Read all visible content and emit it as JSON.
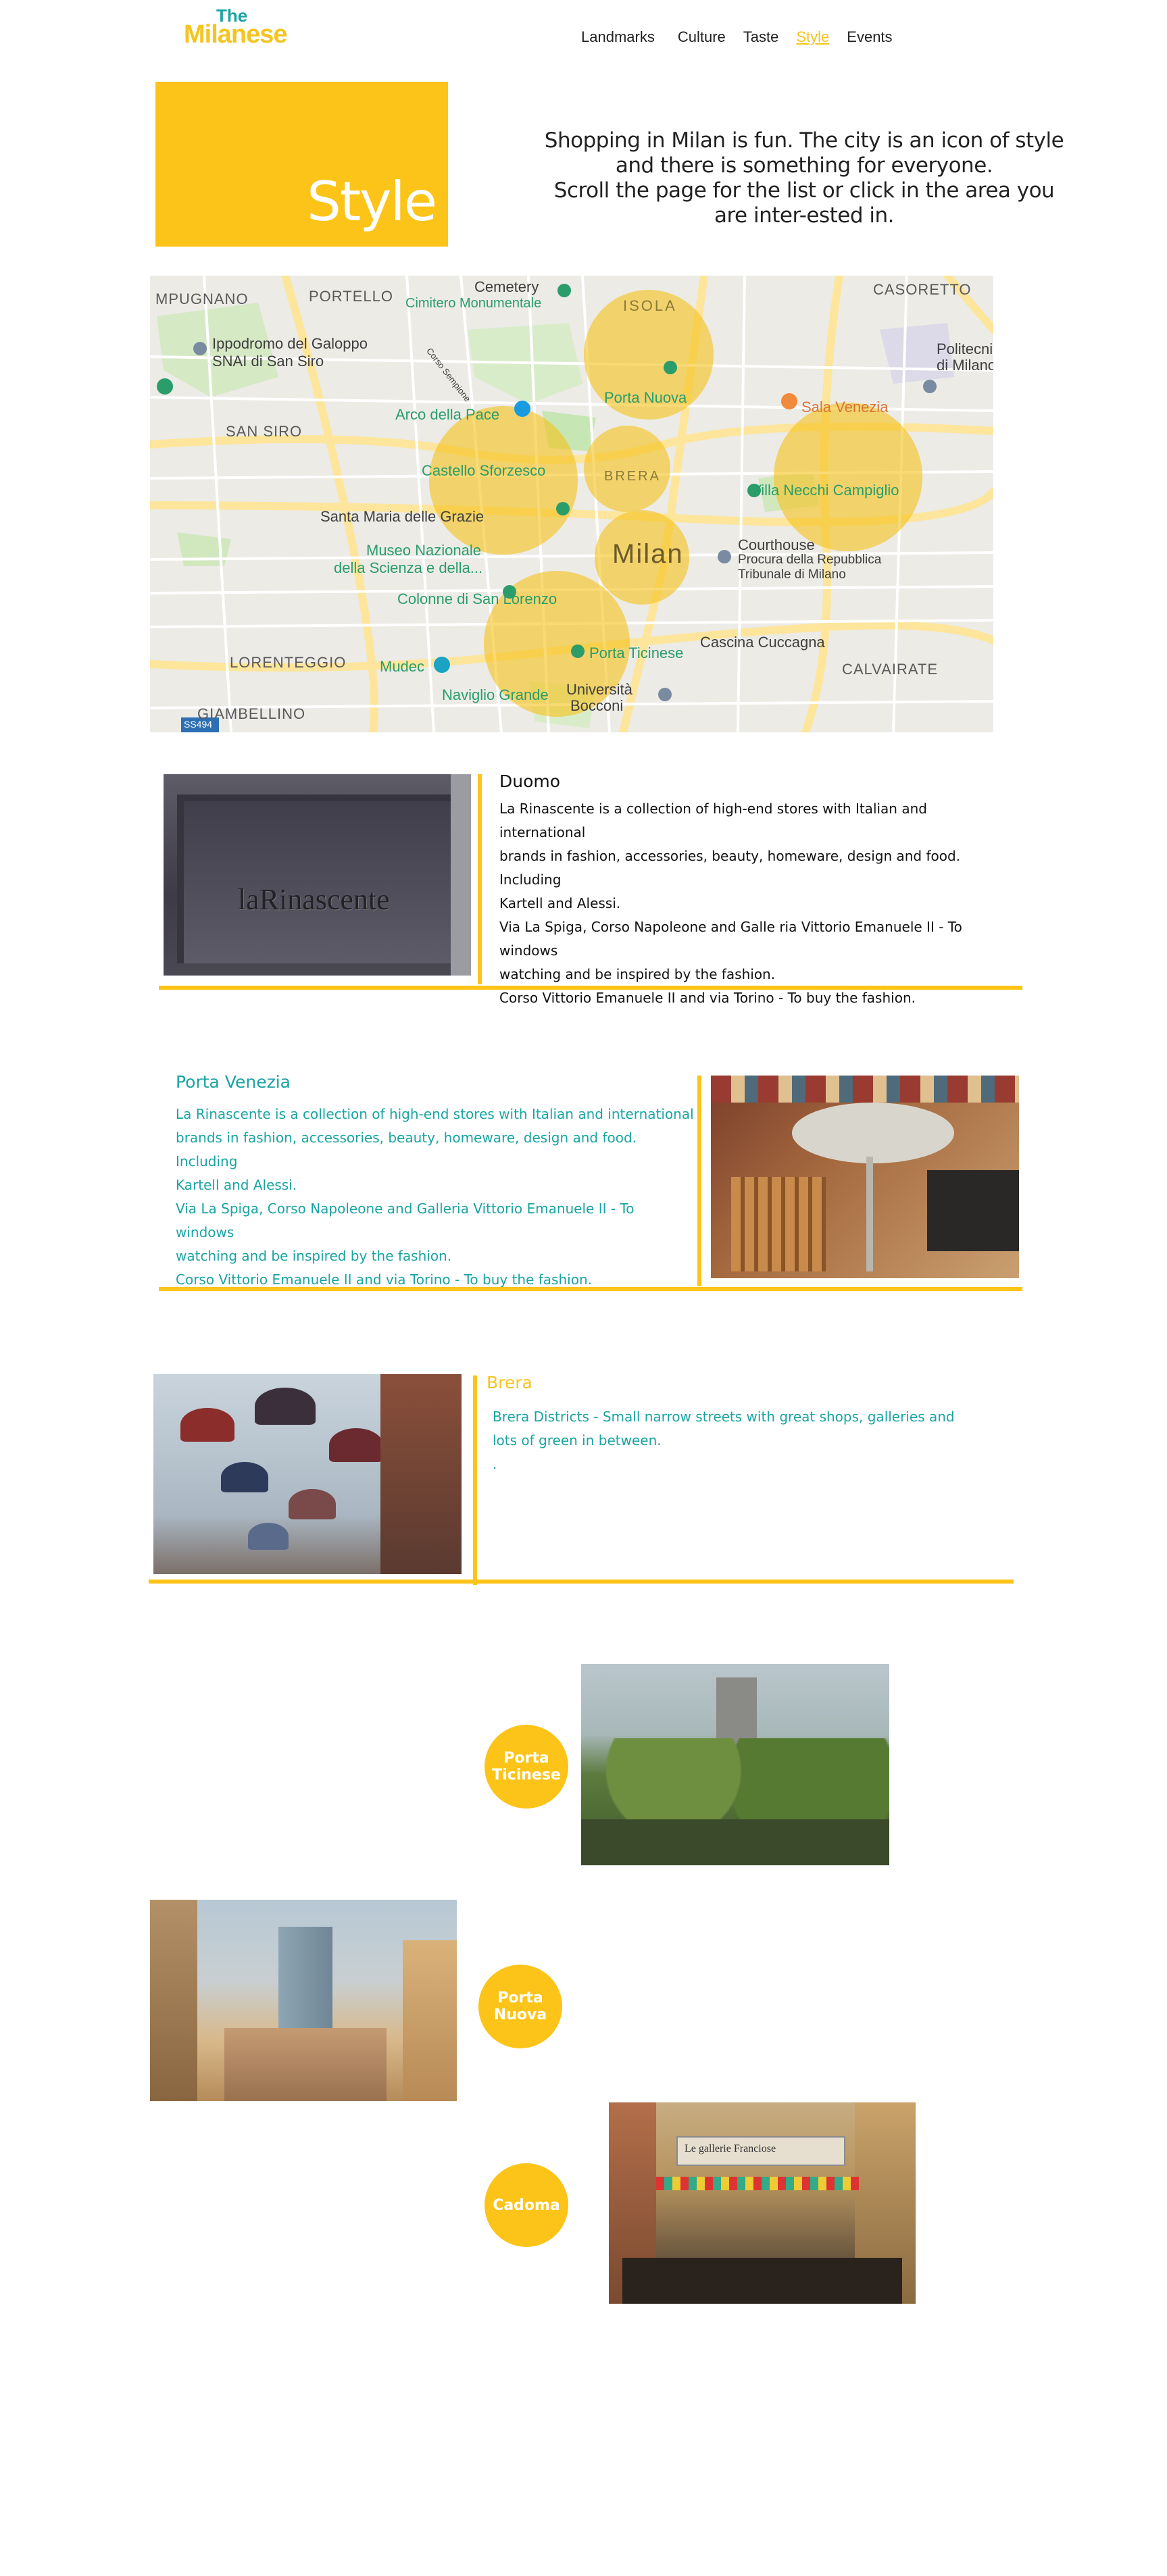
{
  "logo": {
    "the": "The",
    "name": "Milanese"
  },
  "nav": [
    {
      "label": "Landmarks",
      "active": false
    },
    {
      "label": "Culture",
      "active": false
    },
    {
      "label": "Taste",
      "active": false
    },
    {
      "label": "Style",
      "active": true
    },
    {
      "label": "Events",
      "active": false
    }
  ],
  "hero": {
    "title": "Style",
    "intro_line1": "Shopping in Milan is fun. The city is an icon of style and there is something for everyone.",
    "intro_line2": "Scroll the page for the list or click in the area you are inter-ested in."
  },
  "map": {
    "city": "Milan",
    "areas": [
      "ISOLA",
      "BRERA",
      "PORTELLO",
      "SAN SIRO",
      "LORENTEGGIO",
      "GIAMBELLINO",
      "CASORETTO",
      "CALVAIRATE",
      "MPUGNANO"
    ],
    "places": [
      "Cemetery",
      "Cimitero Monumentale",
      "Ippodromo del Galoppo",
      "SNAI di San Siro",
      "Politecnico",
      "di Milano",
      "Arco della Pace",
      "Porta Nuova",
      "Sala Venezia",
      "Castello Sforzesco",
      "Villa Necchi Campiglio",
      "Santa Maria delle Grazie",
      "Museo Nazionale",
      "della Scienza e della...",
      "Courthouse",
      "Procura della Repubblica",
      "Tribunale di Milano",
      "Colonne di San Lorenzo",
      "Cascina Cuccagna",
      "Mudec",
      "Porta Ticinese",
      "Naviglio Grande",
      "Università",
      "Bocconi",
      "SS494",
      "Corso Sempione"
    ],
    "colors": {
      "highlight": "#f5c41f",
      "park": "#c6e6b4",
      "road": "#fde59b"
    }
  },
  "duomo": {
    "title": "Duomo",
    "sign": "laRinascente",
    "lines": [
      "La Rinascente is a collection of high-end stores with Italian and international",
      "brands in    fashion, accessories, beauty, homeware, design and food. Including",
      "Kartell and Alessi.",
      "Via La Spiga, Corso Napoleone and Galle ria Vittorio Emanuele II - To windows",
      "watching and be inspired by the fashion.",
      "Corso Vittorio Emanuele II and via Torino - To buy the fashion."
    ]
  },
  "porta_venezia": {
    "title": "Porta Venezia",
    "lines": [
      "La Rinascente is a collection of high-end stores with Italian and international",
      "brands in    fashion, accessories, beauty, homeware, design and food. Including",
      "Kartell and Alessi.",
      "Via La Spiga, Corso Napoleone and Galleria Vittorio Emanuele II - To windows",
      "watching and be inspired by the fashion.",
      "Corso Vittorio Emanuele II and via Torino - To buy the fashion."
    ]
  },
  "brera": {
    "title": "Brera",
    "lines": [
      "Brera Districts - Small narrow streets with great shops, galleries and",
      "lots of green in between.",
      "."
    ]
  },
  "circles": {
    "ticinese": [
      "Porta",
      "Ticinese"
    ],
    "nuova": [
      "Porta",
      "Nuova"
    ],
    "cadorna": "Cadoma"
  },
  "cadorna_banner": "Le gallerie Franciose",
  "colors": {
    "accent": "#fcc419",
    "teal": "#1aa3a3"
  }
}
